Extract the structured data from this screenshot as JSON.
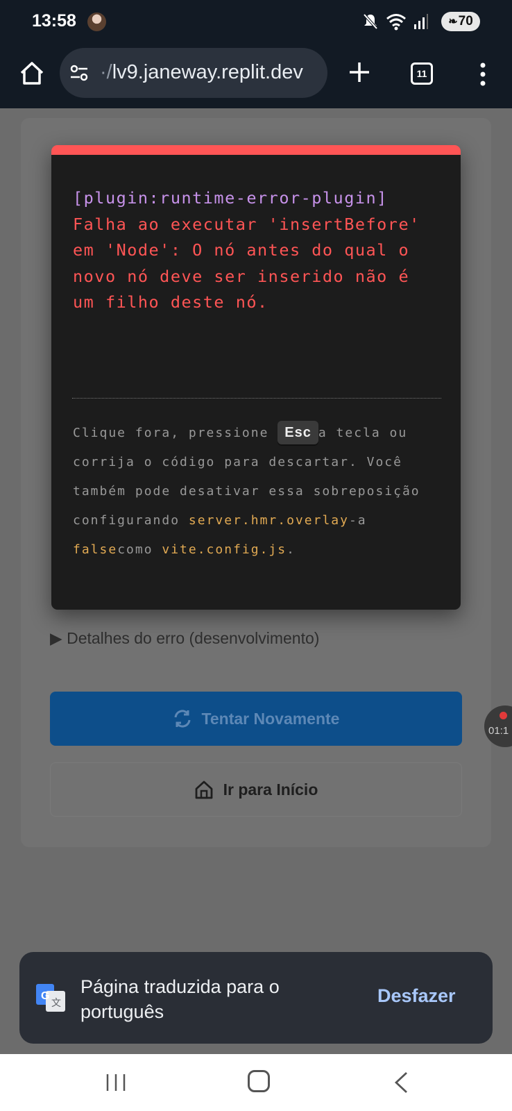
{
  "status_bar": {
    "time": "13:58",
    "battery": "70",
    "icons": [
      "mute-icon",
      "wifi-icon",
      "signal-icon"
    ]
  },
  "browser": {
    "url_faded_prefix": "·/",
    "url": "lv9.janeway.replit.dev",
    "tab_count": "11"
  },
  "error_overlay": {
    "plugin": "[plugin:runtime-error-plugin]",
    "message": "Falha ao executar 'insertBefore' em 'Node': O nó antes do qual o novo nó deve ser inserido não é um filho deste nó.",
    "tip_part1": "Clique fora, pressione ",
    "tip_key": "Esc",
    "tip_part2": "a tecla ou corrija o código para descartar.",
    "tip_part3": "Você também pode desativar essa sobreposição configurando ",
    "tip_code1": "server.hmr.overlay",
    "tip_part4": "-a ",
    "tip_code2": "false",
    "tip_part5": "como ",
    "tip_code3": "vite.config.js",
    "tip_part6": "."
  },
  "page": {
    "details_label": "▶ Detalhes do erro (desenvolvimento)",
    "retry_label": "Tentar Novamente",
    "home_label": "Ir para Início"
  },
  "recording": {
    "time": "01:1"
  },
  "translate_snackbar": {
    "message": "Página traduzida para o português",
    "action": "Desfazer"
  },
  "colors": {
    "error_red": "#ff5555",
    "plugin_purple": "#c792ea",
    "code_yellow": "#e2aa53",
    "primary_blue": "#0d4e8a",
    "snackbar_action": "#a8c7fa"
  }
}
